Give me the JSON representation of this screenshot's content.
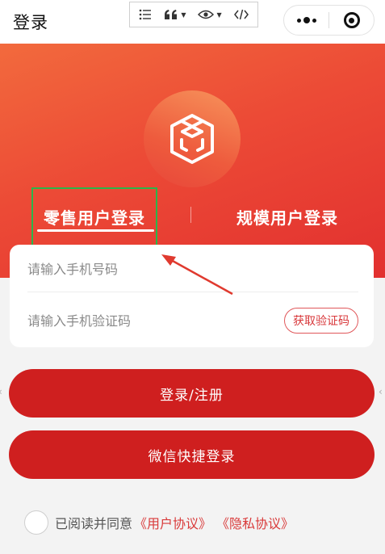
{
  "header": {
    "title": "登录"
  },
  "editor_toolbar": {
    "items": [
      {
        "name": "list",
        "icon": "list-icon"
      },
      {
        "name": "quote",
        "icon": "quote-icon"
      },
      {
        "name": "preview",
        "icon": "eye-icon"
      },
      {
        "name": "code",
        "icon": "code-icon"
      }
    ]
  },
  "capsule": {
    "more_icon": "more-dots-icon",
    "close_icon": "target-icon"
  },
  "tabs": {
    "retail": "零售用户登录",
    "scale": "规模用户登录",
    "active": "retail"
  },
  "form": {
    "phone_placeholder": "请输入手机号码",
    "code_placeholder": "请输入手机验证码",
    "get_code_label": "获取验证码"
  },
  "buttons": {
    "login": "登录/注册",
    "wechat": "微信快捷登录"
  },
  "agreement": {
    "prefix": "已阅读并同意",
    "user_agreement": "《用户协议》",
    "privacy_agreement": "《隐私协议》"
  },
  "colors": {
    "primary": "#cf1f1f",
    "hero_start": "#f26a3d",
    "hero_end": "#e2302f",
    "annotation_green": "#2bb54a",
    "annotation_arrow": "#e03a2f"
  }
}
